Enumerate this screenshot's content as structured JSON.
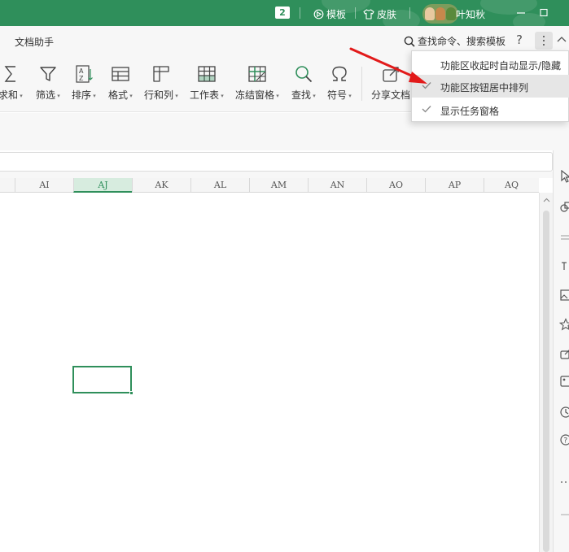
{
  "titlebar": {
    "badge": "2",
    "template_label": "模板",
    "skin_label": "皮肤",
    "user_name": "叶知秋",
    "accent": "#2f8f5b"
  },
  "menu": {
    "doc_assistant": "文档助手",
    "search_placeholder": "查找命令、搜索模板",
    "help": "?"
  },
  "ribbon": {
    "sum": "求和",
    "filter": "筛选",
    "sort": "排序",
    "format": "格式",
    "rowcol": "行和列",
    "worksheet": "工作表",
    "freeze": "冻结窗格",
    "find": "查找",
    "symbol": "符号",
    "share": "分享文档"
  },
  "columns": [
    "AI",
    "AJ",
    "AK",
    "AL",
    "AM",
    "AN",
    "AO",
    "AP",
    "AQ"
  ],
  "active_column": "AJ",
  "dropdown": {
    "items": [
      {
        "label": "功能区收起时自动显示/隐藏",
        "checked": false
      },
      {
        "label": "功能区按钮居中排列",
        "checked": true
      },
      {
        "label": "显示任务窗格",
        "checked": true
      }
    ]
  }
}
